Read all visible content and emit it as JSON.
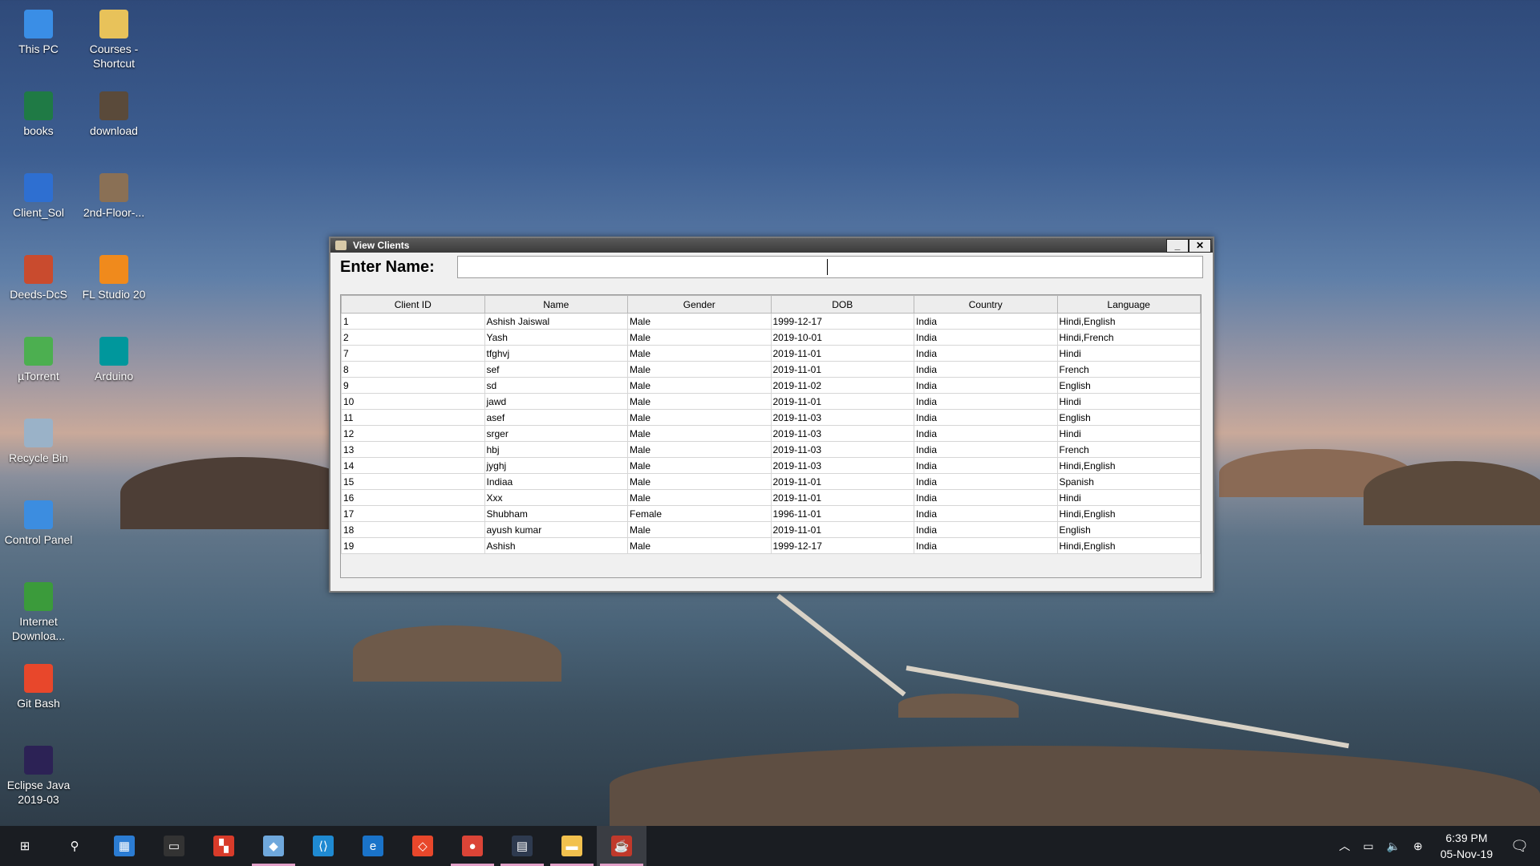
{
  "desktop": {
    "icons": [
      {
        "label": "This PC",
        "icon": "computer-icon",
        "color": "#3a8ee6"
      },
      {
        "label": "Courses - Shortcut",
        "icon": "folder-icon",
        "color": "#e8c25a"
      },
      {
        "label": "books",
        "icon": "excel-icon",
        "color": "#1f7a45"
      },
      {
        "label": "download",
        "icon": "image-icon",
        "color": "#5a4a3a"
      },
      {
        "label": "Client_Sol",
        "icon": "app-icon",
        "color": "#2e6fd1"
      },
      {
        "label": "2nd-Floor-...",
        "icon": "image-icon",
        "color": "#8a7055"
      },
      {
        "label": "Deeds-DcS",
        "icon": "circuit-icon",
        "color": "#c94b2e"
      },
      {
        "label": "FL Studio 20",
        "icon": "fruit-icon",
        "color": "#f08a1c"
      },
      {
        "label": "µTorrent",
        "icon": "utorrent-icon",
        "color": "#4caf50"
      },
      {
        "label": "Arduino",
        "icon": "arduino-icon",
        "color": "#00979c"
      },
      {
        "label": "Recycle Bin",
        "icon": "recycle-bin-icon",
        "color": "#9ab2c8"
      },
      {
        "label": "Control Panel",
        "icon": "control-panel-icon",
        "color": "#3c8de0"
      },
      {
        "label": "Internet Downloa...",
        "icon": "globe-icon",
        "color": "#3b9b3b"
      },
      {
        "label": "Git Bash",
        "icon": "git-icon",
        "color": "#e8472b"
      },
      {
        "label": "Eclipse Java 2019-03",
        "icon": "eclipse-icon",
        "color": "#2c2255"
      }
    ]
  },
  "window": {
    "title": "View Clients",
    "minimize": "_",
    "close": "✕",
    "search_label": "Enter Name:",
    "search_value": "",
    "columns": [
      "Client ID",
      "Name",
      "Gender",
      "DOB",
      "Country",
      "Language"
    ],
    "rows": [
      [
        "1",
        "Ashish Jaiswal",
        "Male",
        "1999-12-17",
        "India",
        "Hindi,English"
      ],
      [
        "2",
        "Yash",
        "Male",
        "2019-10-01",
        "India",
        "Hindi,French"
      ],
      [
        "7",
        "tfghvj",
        "Male",
        "2019-11-01",
        "India",
        "Hindi"
      ],
      [
        "8",
        "sef",
        "Male",
        "2019-11-01",
        "India",
        "French"
      ],
      [
        "9",
        "sd",
        "Male",
        "2019-11-02",
        "India",
        "English"
      ],
      [
        "10",
        "jawd",
        "Male",
        "2019-11-01",
        "India",
        "Hindi"
      ],
      [
        "11",
        "asef",
        "Male",
        "2019-11-03",
        "India",
        "English"
      ],
      [
        "12",
        "srger",
        "Male",
        "2019-11-03",
        "India",
        "Hindi"
      ],
      [
        "13",
        "hbj",
        "Male",
        "2019-11-03",
        "India",
        "French"
      ],
      [
        "14",
        "jyghj",
        "Male",
        "2019-11-03",
        "India",
        "Hindi,English"
      ],
      [
        "15",
        "Indiaa",
        "Male",
        "2019-11-01",
        "India",
        "Spanish"
      ],
      [
        "16",
        "Xxx",
        "Male",
        "2019-11-01",
        "India",
        "Hindi"
      ],
      [
        "17",
        "Shubham",
        "Female",
        "1996-11-01",
        "India",
        "Hindi,English"
      ],
      [
        "18",
        "ayush kumar",
        "Male",
        "2019-11-01",
        "India",
        "English"
      ],
      [
        "19",
        "Ashish",
        "Male",
        "1999-12-17",
        "India",
        "Hindi,English"
      ]
    ]
  },
  "taskbar": {
    "apps": [
      {
        "name": "start-icon",
        "glyph": "⊞",
        "color": "#1a1d22",
        "state": ""
      },
      {
        "name": "search-icon",
        "glyph": "⚲",
        "color": "#1a1d22",
        "state": ""
      },
      {
        "name": "store-icon",
        "glyph": "▦",
        "color": "#2b7cd3",
        "state": ""
      },
      {
        "name": "terminal-icon",
        "glyph": "▭",
        "color": "#333333",
        "state": ""
      },
      {
        "name": "tiles-icon",
        "glyph": "▚",
        "color": "#d83b2a",
        "state": ""
      },
      {
        "name": "cube-icon",
        "glyph": "◆",
        "color": "#6fa8dc",
        "state": "open"
      },
      {
        "name": "vscode-icon",
        "glyph": "⟨⟩",
        "color": "#1f8ad2",
        "state": ""
      },
      {
        "name": "edge-icon",
        "glyph": "e",
        "color": "#1a73c9",
        "state": ""
      },
      {
        "name": "git-icon",
        "glyph": "◇",
        "color": "#e8472b",
        "state": ""
      },
      {
        "name": "chrome-icon",
        "glyph": "●",
        "color": "#db4437",
        "state": "open"
      },
      {
        "name": "mysql-icon",
        "glyph": "▤",
        "color": "#2e3a4f",
        "state": "open"
      },
      {
        "name": "file-explorer-icon",
        "glyph": "▬",
        "color": "#f2c14e",
        "state": "open"
      },
      {
        "name": "java-icon",
        "glyph": "☕",
        "color": "#c0392b",
        "state": "active"
      }
    ],
    "tray": {
      "time": "6:39 PM",
      "date": "05-Nov-19"
    }
  }
}
